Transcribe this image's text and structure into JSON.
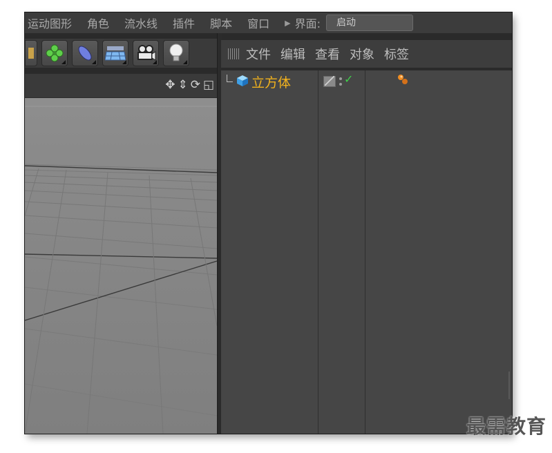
{
  "menubar": {
    "items": [
      "运动图形",
      "角色",
      "流水线",
      "插件",
      "脚本",
      "窗口"
    ],
    "layout_label": "界面:",
    "layout_value": "启动"
  },
  "toolbar": {
    "icons": [
      "partial-tool-icon",
      "cloner-flower-icon",
      "deformer-pill-icon",
      "floor-plane-icon",
      "camera-icon",
      "light-bulb-icon"
    ]
  },
  "viewport": {
    "nav_icons": [
      "move-icon",
      "scale-icon",
      "rotate-icon",
      "maximize-icon"
    ]
  },
  "object_manager": {
    "menu": [
      "文件",
      "编辑",
      "查看",
      "对象",
      "标签"
    ],
    "objects": [
      {
        "name": "立方体",
        "enabled": true
      }
    ]
  },
  "colors": {
    "accent_object": "#f2b21d",
    "check": "#3fd04a"
  },
  "watermark": "最需教育"
}
